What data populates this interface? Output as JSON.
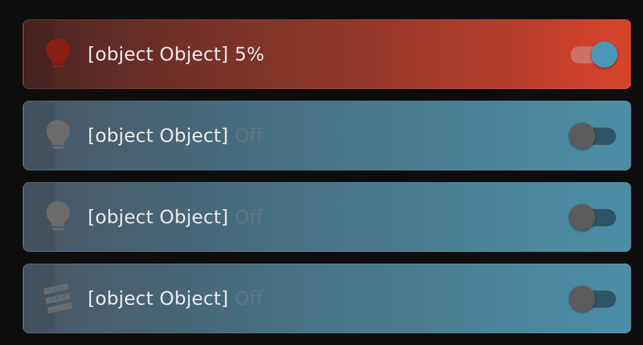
{
  "rows": [
    {
      "name": "[object Object]",
      "state": "5%",
      "on": true,
      "icon": "lightbulb-icon"
    },
    {
      "name": "[object Object]",
      "state": "Off",
      "on": false,
      "icon": "lightbulb-icon"
    },
    {
      "name": "[object Object]",
      "state": "Off",
      "on": false,
      "icon": "lightbulb-icon"
    },
    {
      "name": "[object Object]",
      "state": "Off",
      "on": false,
      "icon": "led-strip-icon"
    }
  ],
  "colors": {
    "on_icon": "#8a1e14",
    "off_icon": "#6b6b6b",
    "on_knob": "#4c97b5",
    "off_knob": "#5b5b5b"
  }
}
